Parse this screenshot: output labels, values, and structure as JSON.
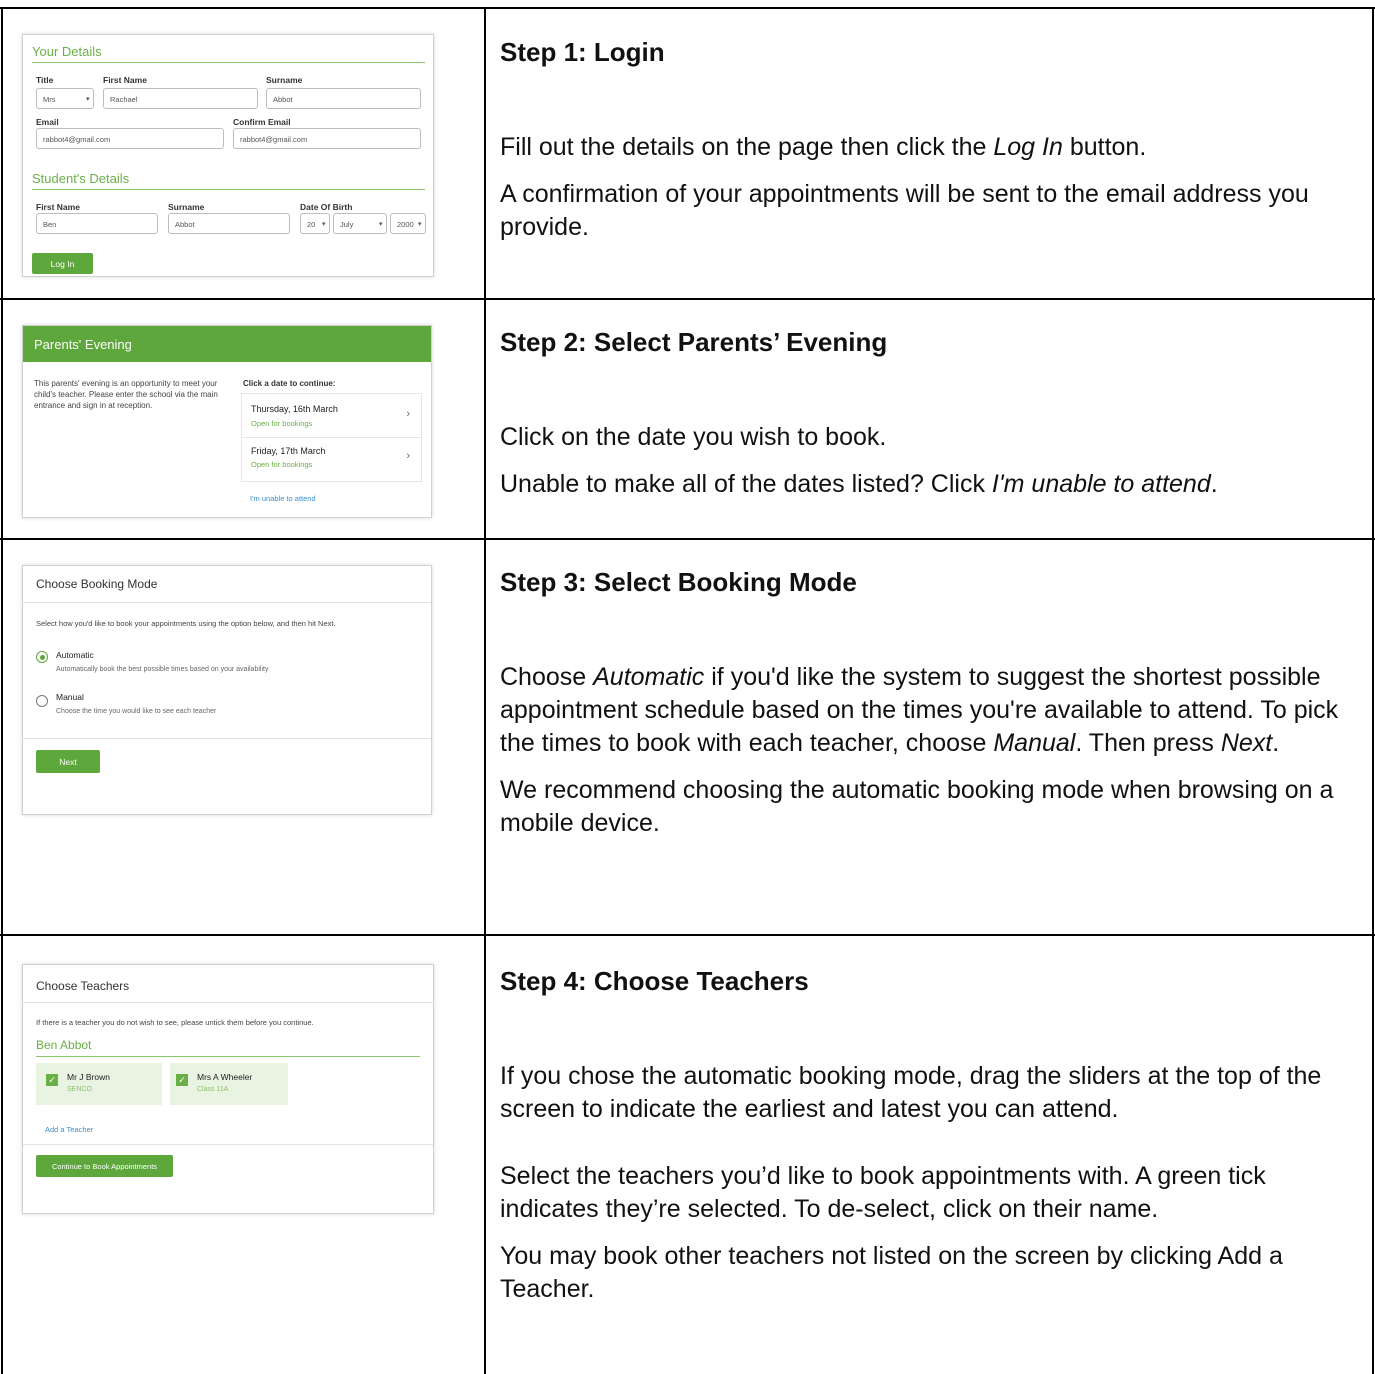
{
  "steps": [
    {
      "title": "Step 1: Login",
      "paragraphs": [
        [
          "Fill out the details on the page then click the ",
          {
            "em": "Log In"
          },
          " button."
        ],
        [
          "A confirmation of your appointments will be sent to the email address you provide."
        ]
      ]
    },
    {
      "title": "Step 2: Select Parents’ Evening",
      "paragraphs": [
        [
          "Click on the date you wish to book."
        ],
        [
          "Unable to make all of the dates listed? Click ",
          {
            "em": "I'm unable to attend"
          },
          "."
        ]
      ]
    },
    {
      "title": "Step 3: Select Booking Mode",
      "paragraphs": [
        [
          "Choose ",
          {
            "em": "Automatic"
          },
          " if you'd like the system to suggest the shortest possible appointment schedule based on the times you're available to attend. To pick the times to book with each teacher, choose ",
          {
            "em": "Manual"
          },
          ". Then press ",
          {
            "em": "Next"
          },
          "."
        ],
        [
          "We recommend choosing the automatic booking mode when browsing on a mobile device."
        ]
      ]
    },
    {
      "title": "Step 4: Choose Teachers",
      "paragraphs": [
        [
          "If you chose the automatic booking mode, drag the sliders at the top of the screen to indicate the earliest and latest you can attend."
        ],
        [
          "Select the teachers you’d like to book appointments with. A green tick indicates they’re selected. To de-select, click on their name."
        ],
        [
          "You may book other teachers not listed on the screen by clicking Add a Teacher."
        ]
      ]
    }
  ],
  "login": {
    "your_details": "Your Details",
    "title_label": "Title",
    "title_value": "Mrs",
    "first_name_label": "First Name",
    "first_name_value": "Rachael",
    "surname_label": "Surname",
    "surname_value": "Abbot",
    "email_label": "Email",
    "email_value": "rabbot4@gmail.com",
    "confirm_email_label": "Confirm Email",
    "confirm_email_value": "rabbot4@gmail.com",
    "students_details": "Student's Details",
    "s_first_name_label": "First Name",
    "s_first_name_value": "Ben",
    "s_surname_label": "Surname",
    "s_surname_value": "Abbot",
    "dob_label": "Date Of Birth",
    "dob_day": "20",
    "dob_month": "July",
    "dob_year": "2000",
    "login_button": "Log In"
  },
  "evening": {
    "header": "Parents' Evening",
    "description": "This parents' evening is an opportunity to meet your child's teacher. Please enter the school via the main entrance and sign in at reception.",
    "click_prompt": "Click a date to continue:",
    "dates": [
      {
        "date": "Thursday, 16th March",
        "status": "Open for bookings"
      },
      {
        "date": "Friday, 17th March",
        "status": "Open for bookings"
      }
    ],
    "unable_link": "I'm unable to attend"
  },
  "mode": {
    "header": "Choose Booking Mode",
    "instruction": "Select how you'd like to book your appointments using the option below, and then hit Next.",
    "automatic_label": "Automatic",
    "automatic_desc": "Automatically book the best possible times based on your availability",
    "manual_label": "Manual",
    "manual_desc": "Choose the time you would like to see each teacher",
    "next_button": "Next"
  },
  "teachers": {
    "header": "Choose Teachers",
    "instruction": "If there is a teacher you do not wish to see, please untick them before you continue.",
    "student_name": "Ben Abbot",
    "list": [
      {
        "name": "Mr J Brown",
        "role": "SENCO"
      },
      {
        "name": "Mrs A Wheeler",
        "role": "Class 11A"
      }
    ],
    "add_link": "Add a Teacher",
    "continue_button": "Continue to Book Appointments"
  },
  "colors": {
    "accent_green": "#5ea73c",
    "section_green": "#6ab046",
    "link_blue": "#3a8fd6"
  }
}
